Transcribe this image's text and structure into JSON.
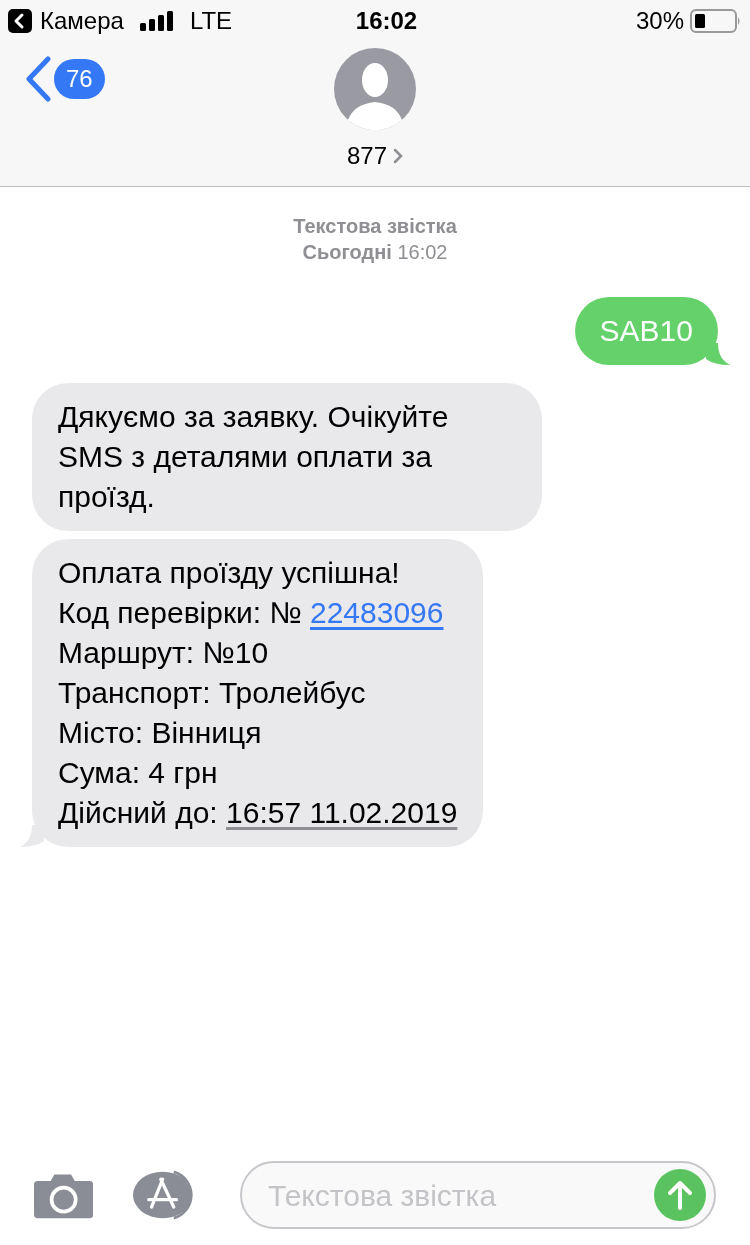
{
  "status_bar": {
    "back_app": "Камера",
    "network": "LTE",
    "time": "16:02",
    "battery": "30%"
  },
  "header": {
    "unread_count": "76",
    "contact": "877"
  },
  "timestamp": {
    "service": "Текстова звістка",
    "when": "**Сьогодні** 16:02"
  },
  "messages": [
    {
      "kind": "outgoing",
      "lines": [
        [
          {
            "kind": "text",
            "text": "SAB10"
          }
        ]
      ]
    },
    {
      "kind": "incoming",
      "lines": [
        [
          {
            "kind": "text",
            "text": "Дякуємо за заявку. Очікуйте SMS з деталями оплати за проїзд."
          }
        ]
      ]
    },
    {
      "kind": "incoming",
      "lines": [
        [
          {
            "kind": "text",
            "text": "Оплата проїзду успішна!"
          }
        ],
        [
          {
            "kind": "text",
            "text": "Код перевірки: № "
          },
          {
            "kind": "link",
            "text": "22483096"
          }
        ],
        [
          {
            "kind": "text",
            "text": "Маршрут: №10"
          }
        ],
        [
          {
            "kind": "text",
            "text": "Транспорт: Тролейбус"
          }
        ],
        [
          {
            "kind": "text",
            "text": "Місто: Вінниця"
          }
        ],
        [
          {
            "kind": "text",
            "text": "Сума: 4 грн"
          }
        ],
        [
          {
            "kind": "text",
            "text": "Дійсний до: "
          },
          {
            "kind": "date",
            "text": "16:57 11.02.2019"
          }
        ]
      ]
    }
  ],
  "composer": {
    "placeholder": "Текстова звістка"
  }
}
